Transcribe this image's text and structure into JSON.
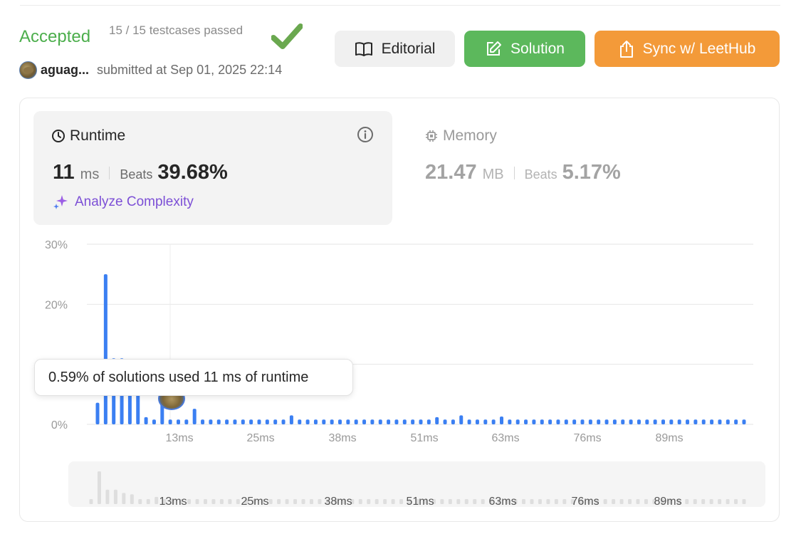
{
  "header": {
    "status": "Accepted",
    "testcases": "15 / 15 testcases passed",
    "username": "aguag...",
    "submitted": "submitted at Sep 01, 2025 22:14"
  },
  "buttons": {
    "editorial": "Editorial",
    "solution": "Solution",
    "sync": "Sync w/ LeetHub"
  },
  "runtime": {
    "title": "Runtime",
    "value": "11",
    "unit": "ms",
    "beats_label": "Beats",
    "beats": "39.68%",
    "analyze": "Analyze Complexity"
  },
  "memory": {
    "title": "Memory",
    "value": "21.47",
    "unit": "MB",
    "beats_label": "Beats",
    "beats": "5.17%"
  },
  "tooltip": "0.59% of solutions used 11 ms of runtime",
  "colors": {
    "accepted": "#4cae4c",
    "solution_btn": "#5cb85c",
    "sync_btn": "#f39a39",
    "bar": "#3b7ff2",
    "analyze": "#7c4fd6"
  },
  "icons": {
    "check": "check-icon",
    "editorial": "book-icon",
    "solution": "edit-icon",
    "sync": "share-icon",
    "runtime": "clock-icon",
    "memory": "chip-icon",
    "info": "info-icon",
    "analyze": "sparkle-icon"
  },
  "chart_data": {
    "type": "bar",
    "ylabel": "",
    "xlabel": "",
    "y_ticks": [
      "30%",
      "20%",
      "0%"
    ],
    "y_tick_values": [
      30,
      20,
      0
    ],
    "ylim": [
      0,
      30
    ],
    "x_ticks": [
      "13ms",
      "25ms",
      "38ms",
      "51ms",
      "63ms",
      "76ms",
      "89ms"
    ],
    "values": [
      3.6,
      25.0,
      11.0,
      11.0,
      8.5,
      7.5,
      1.2,
      0.8,
      5.5,
      0.8,
      0.8,
      0.8,
      2.6,
      0.8,
      0.8,
      0.8,
      0.8,
      0.8,
      0.8,
      0.8,
      0.8,
      0.8,
      0.8,
      0.8,
      1.5,
      0.8,
      0.8,
      0.8,
      0.8,
      0.8,
      0.8,
      0.8,
      0.8,
      0.8,
      0.8,
      0.8,
      0.8,
      0.8,
      0.8,
      0.8,
      0.8,
      0.8,
      1.2,
      0.8,
      0.8,
      1.5,
      0.8,
      0.8,
      0.8,
      0.8,
      1.3,
      0.8,
      0.8,
      0.8,
      0.8,
      0.8,
      0.8,
      0.8,
      0.8,
      0.8,
      0.8,
      0.8,
      0.8,
      0.8,
      0.8,
      0.8,
      0.8,
      0.8,
      0.8,
      0.8,
      0.8,
      0.8,
      0.8,
      0.8,
      0.8,
      0.8,
      0.8,
      0.8,
      0.8,
      0.8,
      0.8
    ],
    "highlight": {
      "runtime_ms": 11,
      "percent": 0.59
    },
    "grid": true
  },
  "mini_chart": {
    "x_ticks": [
      "13ms",
      "25ms",
      "38ms",
      "51ms",
      "63ms",
      "76ms",
      "89ms"
    ]
  }
}
